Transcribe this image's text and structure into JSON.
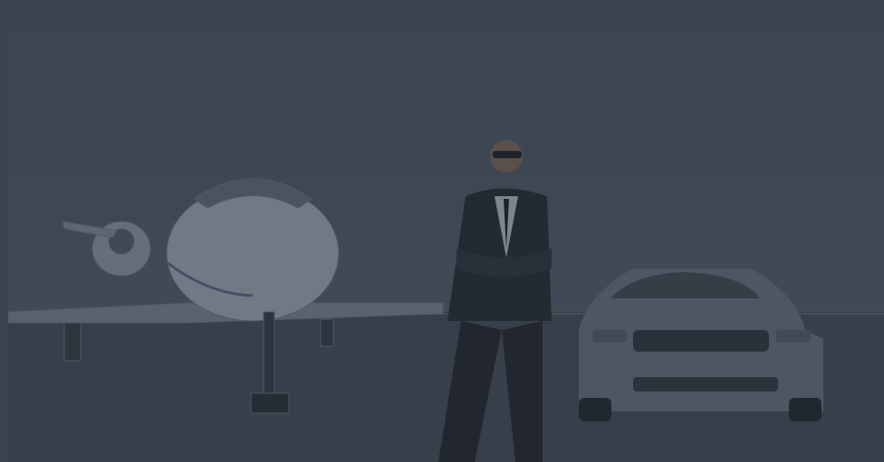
{
  "hero": {
    "image_subject": "businessman-with-jet-and-sports-car",
    "overlay_color": "#2c3440"
  }
}
